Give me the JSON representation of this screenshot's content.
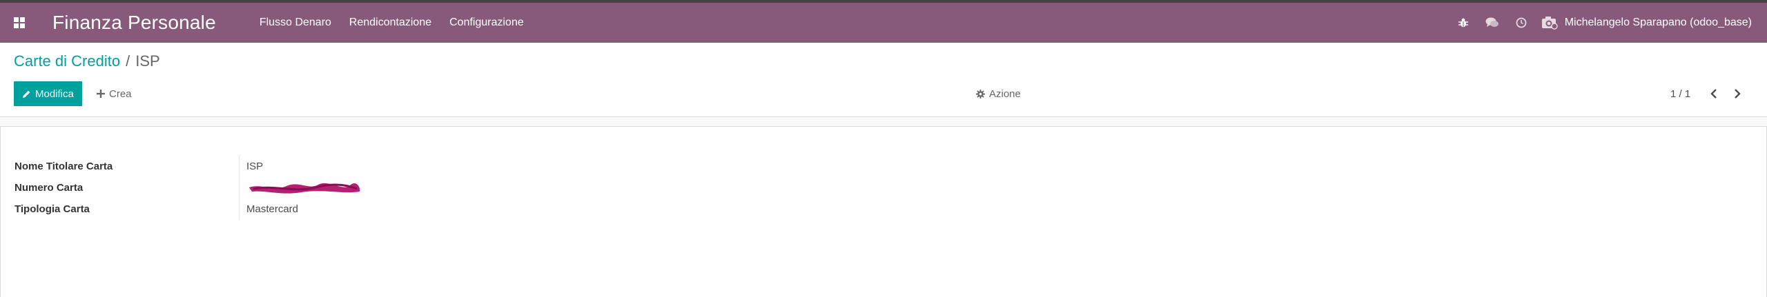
{
  "navbar": {
    "brand": "Finanza Personale",
    "menu": [
      {
        "label": "Flusso Denaro"
      },
      {
        "label": "Rendicontazione"
      },
      {
        "label": "Configurazione"
      }
    ],
    "user_label": "Michelangelo Sparapano (odoo_base)"
  },
  "breadcrumb": {
    "parent": "Carte di Credito",
    "separator": "/",
    "current": "ISP"
  },
  "toolbar": {
    "edit_label": "Modifica",
    "create_label": "Crea",
    "action_label": "Azione"
  },
  "pager": {
    "value": "1 / 1"
  },
  "form": {
    "fields": [
      {
        "label": "Nome Titolare Carta",
        "value": "ISP"
      },
      {
        "label": "Numero Carta",
        "value": ""
      },
      {
        "label": "Tipologia Carta",
        "value": "Mastercard"
      }
    ]
  },
  "colors": {
    "navbar": "#875a7b",
    "accent": "#00a09d",
    "redaction": "#b0146a"
  },
  "icons": [
    "apps-grid-icon",
    "bug-icon",
    "chat-bubbles-icon",
    "clock-icon",
    "camera-icon",
    "pencil-icon",
    "plus-icon",
    "gear-icon",
    "chevron-left-icon",
    "chevron-right-icon"
  ]
}
